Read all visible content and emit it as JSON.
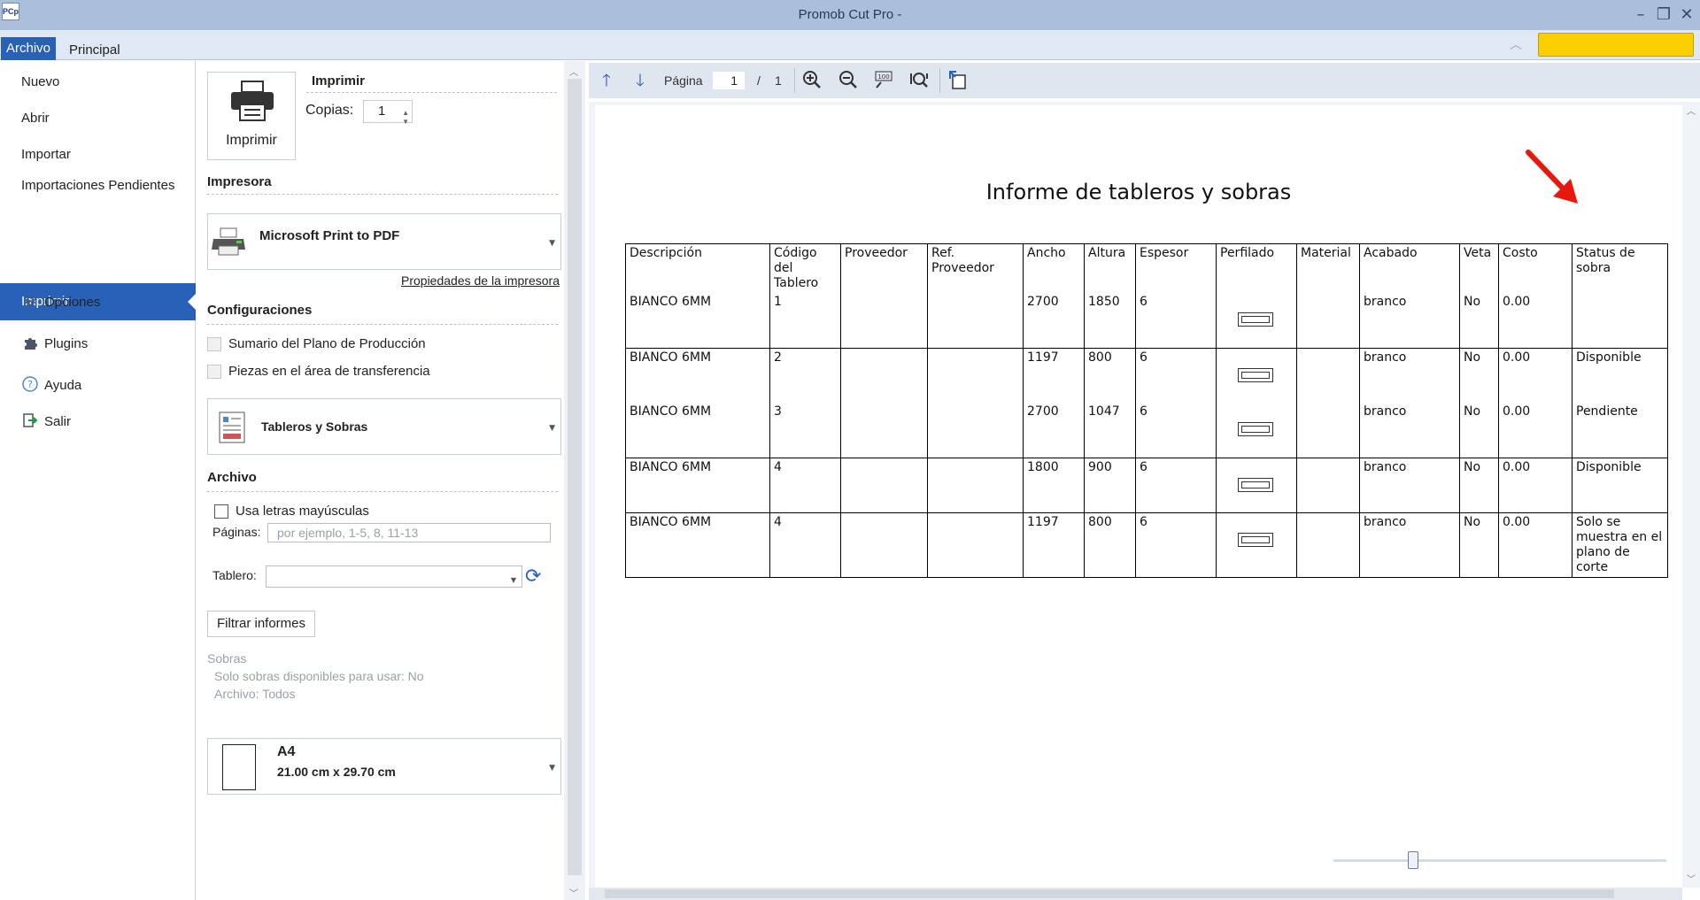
{
  "window": {
    "title": "Promob Cut Pro -",
    "app_icon": "PCp"
  },
  "menu": {
    "tabs": [
      "Archivo",
      "Principal"
    ]
  },
  "nav": {
    "items": [
      "Nuevo",
      "Abrir",
      "Importar",
      "Importaciones Pendientes"
    ],
    "active": "Imprimir",
    "icon_items": [
      {
        "label": "Opciones",
        "icon": "gear-icon"
      },
      {
        "label": "Plugins",
        "icon": "puzzle-icon"
      },
      {
        "label": "Ayuda",
        "icon": "help-icon"
      },
      {
        "label": "Salir",
        "icon": "exit-icon"
      }
    ]
  },
  "print": {
    "button_label": "Imprimir",
    "section_label": "Imprimir",
    "copies_label": "Copias:",
    "copies_value": "1",
    "printer_section": "Impresora",
    "printer_name": "Microsoft Print to PDF",
    "printer_properties_link": "Propiedades de la impresora",
    "config_section": "Configuraciones",
    "option_summary": "Sumario del Plano de Producción",
    "option_transfer": "Piezas en el área de transferencia",
    "report_select": "Tableros y Sobras",
    "file_section": "Archivo",
    "uppercase_label": "Usa letras mayúsculas",
    "pages_label": "Páginas:",
    "pages_placeholder": "por ejemplo, 1-5, 8, 11-13",
    "board_label": "Tablero:",
    "filter_button": "Filtrar informes",
    "filter_summary": [
      "Sobras",
      "Solo sobras disponibles para usar: No",
      "Archivo: Todos"
    ],
    "paper_name": "A4",
    "paper_size": "21.00 cm x 29.70 cm"
  },
  "preview_toolbar": {
    "page_label": "Página",
    "page_current": "1",
    "page_separator": "/",
    "page_total": "1"
  },
  "report": {
    "title": "Informe de tableros y sobras",
    "columns": [
      "Descripción",
      "Código del Tablero",
      "Proveedor",
      "Ref. Proveedor",
      "Ancho",
      "Altura",
      "Espesor",
      "Perfilado",
      "Material",
      "Acabado",
      "Veta",
      "Costo",
      "Status de sobra"
    ],
    "rows": [
      [
        "BIANCO 6MM",
        "1",
        "",
        "",
        "2700",
        "1850",
        "6",
        "",
        "",
        "branco",
        "No",
        "0.00",
        ""
      ],
      [
        "BIANCO 6MM",
        "2",
        "",
        "",
        "1197",
        "800",
        "6",
        "",
        "",
        "branco",
        "No",
        "0.00",
        "Disponible"
      ],
      [
        "BIANCO 6MM",
        "3",
        "",
        "",
        "2700",
        "1047",
        "6",
        "",
        "",
        "branco",
        "No",
        "0.00",
        "Pendiente"
      ],
      [
        "BIANCO 6MM",
        "4",
        "",
        "",
        "1800",
        "900",
        "6",
        "",
        "",
        "branco",
        "No",
        "0.00",
        "Disponible"
      ],
      [
        "BIANCO 6MM",
        "4",
        "",
        "",
        "1197",
        "800",
        "6",
        "",
        "",
        "branco",
        "No",
        "0.00",
        "Solo se muestra en el plano de corte"
      ]
    ]
  },
  "colors": {
    "accent": "#2a61b8",
    "titlebar": "#a9bfdb",
    "user_box": "#fcd000",
    "arrow": "#e8180c"
  }
}
